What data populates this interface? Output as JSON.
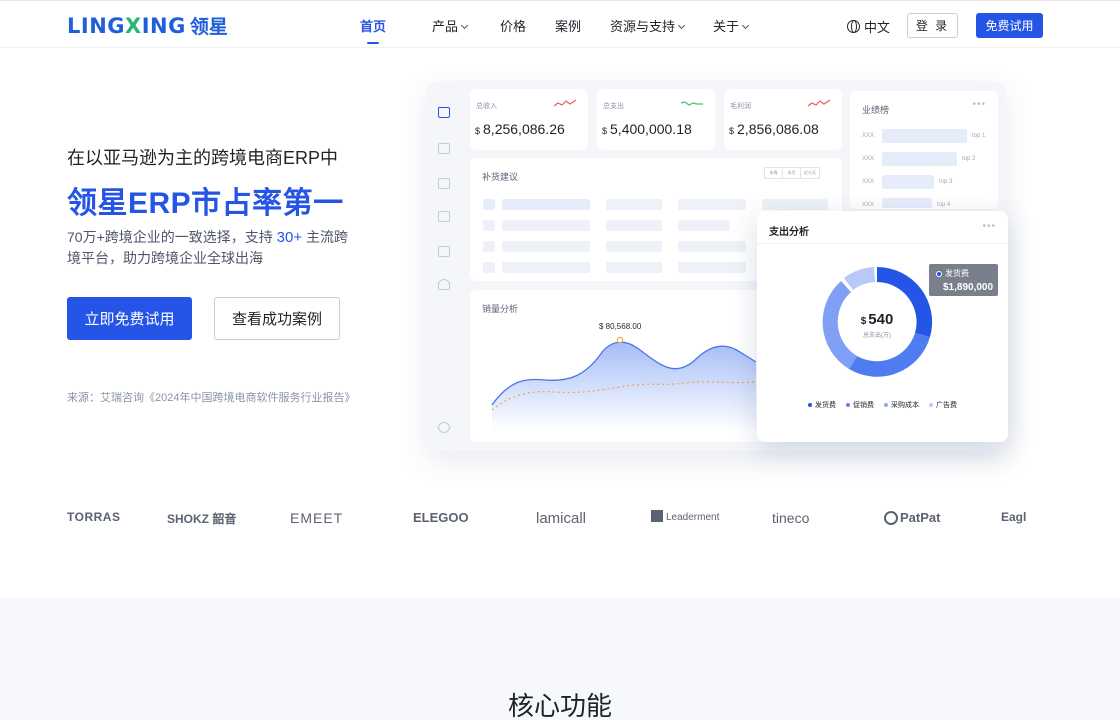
{
  "header": {
    "logo_en_a": "LING",
    "logo_en_b": "X",
    "logo_en_c": "ING",
    "logo_zh": "领星",
    "nav": [
      {
        "label": "首页",
        "active": true
      },
      {
        "label": "产品",
        "dropdown": true
      },
      {
        "label": "价格"
      },
      {
        "label": "案例"
      },
      {
        "label": "资源与支持",
        "dropdown": true
      },
      {
        "label": "关于",
        "dropdown": true
      }
    ],
    "language": "中文",
    "login_label": "登 录",
    "trial_label": "免费试用"
  },
  "hero": {
    "subtitle": "在以亚马逊为主的跨境电商ERP中",
    "title": "领星ERP市占率第一",
    "desc_a": "70万+跨境企业的一致选择，支持 ",
    "desc_highlight": "30+",
    "desc_b": " 主流跨境平台，助力跨境企业全球出海",
    "cta_primary": "立即免费试用",
    "cta_secondary": "查看成功案例",
    "source": "来源：艾瑞咨询《2024年中国跨境电商软件服务行业报告》"
  },
  "dashboard": {
    "kpis": [
      {
        "label": "总收入",
        "currency": "$",
        "value": "8,256,086.26",
        "trend_color": "#f05a5a"
      },
      {
        "label": "总支出",
        "currency": "$",
        "value": "5,400,000.18",
        "trend_color": "#3cc86a"
      },
      {
        "label": "毛利润",
        "currency": "$",
        "value": "2,856,086.08",
        "trend_color": "#f05a5a"
      }
    ],
    "ranking_title": "业绩榜",
    "ranking": [
      {
        "name": "XXX",
        "tag": "top 1"
      },
      {
        "name": "XXX",
        "tag": "top 2"
      },
      {
        "name": "XXX",
        "tag": "top 3"
      },
      {
        "name": "XXX",
        "tag": "top 4"
      }
    ],
    "restock_title": "补货建议",
    "restock_tabs": [
      "本周",
      "本月",
      "近七天"
    ],
    "sales_title": "销量分析",
    "sales_peak_label": "$ 80,568.00",
    "expense": {
      "title": "支出分析",
      "tooltip_label": "发货费",
      "tooltip_value": "$1,890,000",
      "center_currency": "$",
      "center_value": "540",
      "center_label": "总支出(万)",
      "legend": [
        {
          "label": "发货费",
          "color": "#2455e6"
        },
        {
          "label": "促销费",
          "color": "#5b86f0"
        },
        {
          "label": "采购成本",
          "color": "#8aa8f5"
        },
        {
          "label": "广告费",
          "color": "#b8c9f8"
        }
      ]
    }
  },
  "brands": [
    "TORRAS",
    "SHOKZ 韶音",
    "EMEET",
    "ELEGOO",
    "lamicall",
    "Leaderment",
    "tineco",
    "PatPat",
    "Eagl"
  ],
  "section": {
    "title": "核心功能"
  }
}
